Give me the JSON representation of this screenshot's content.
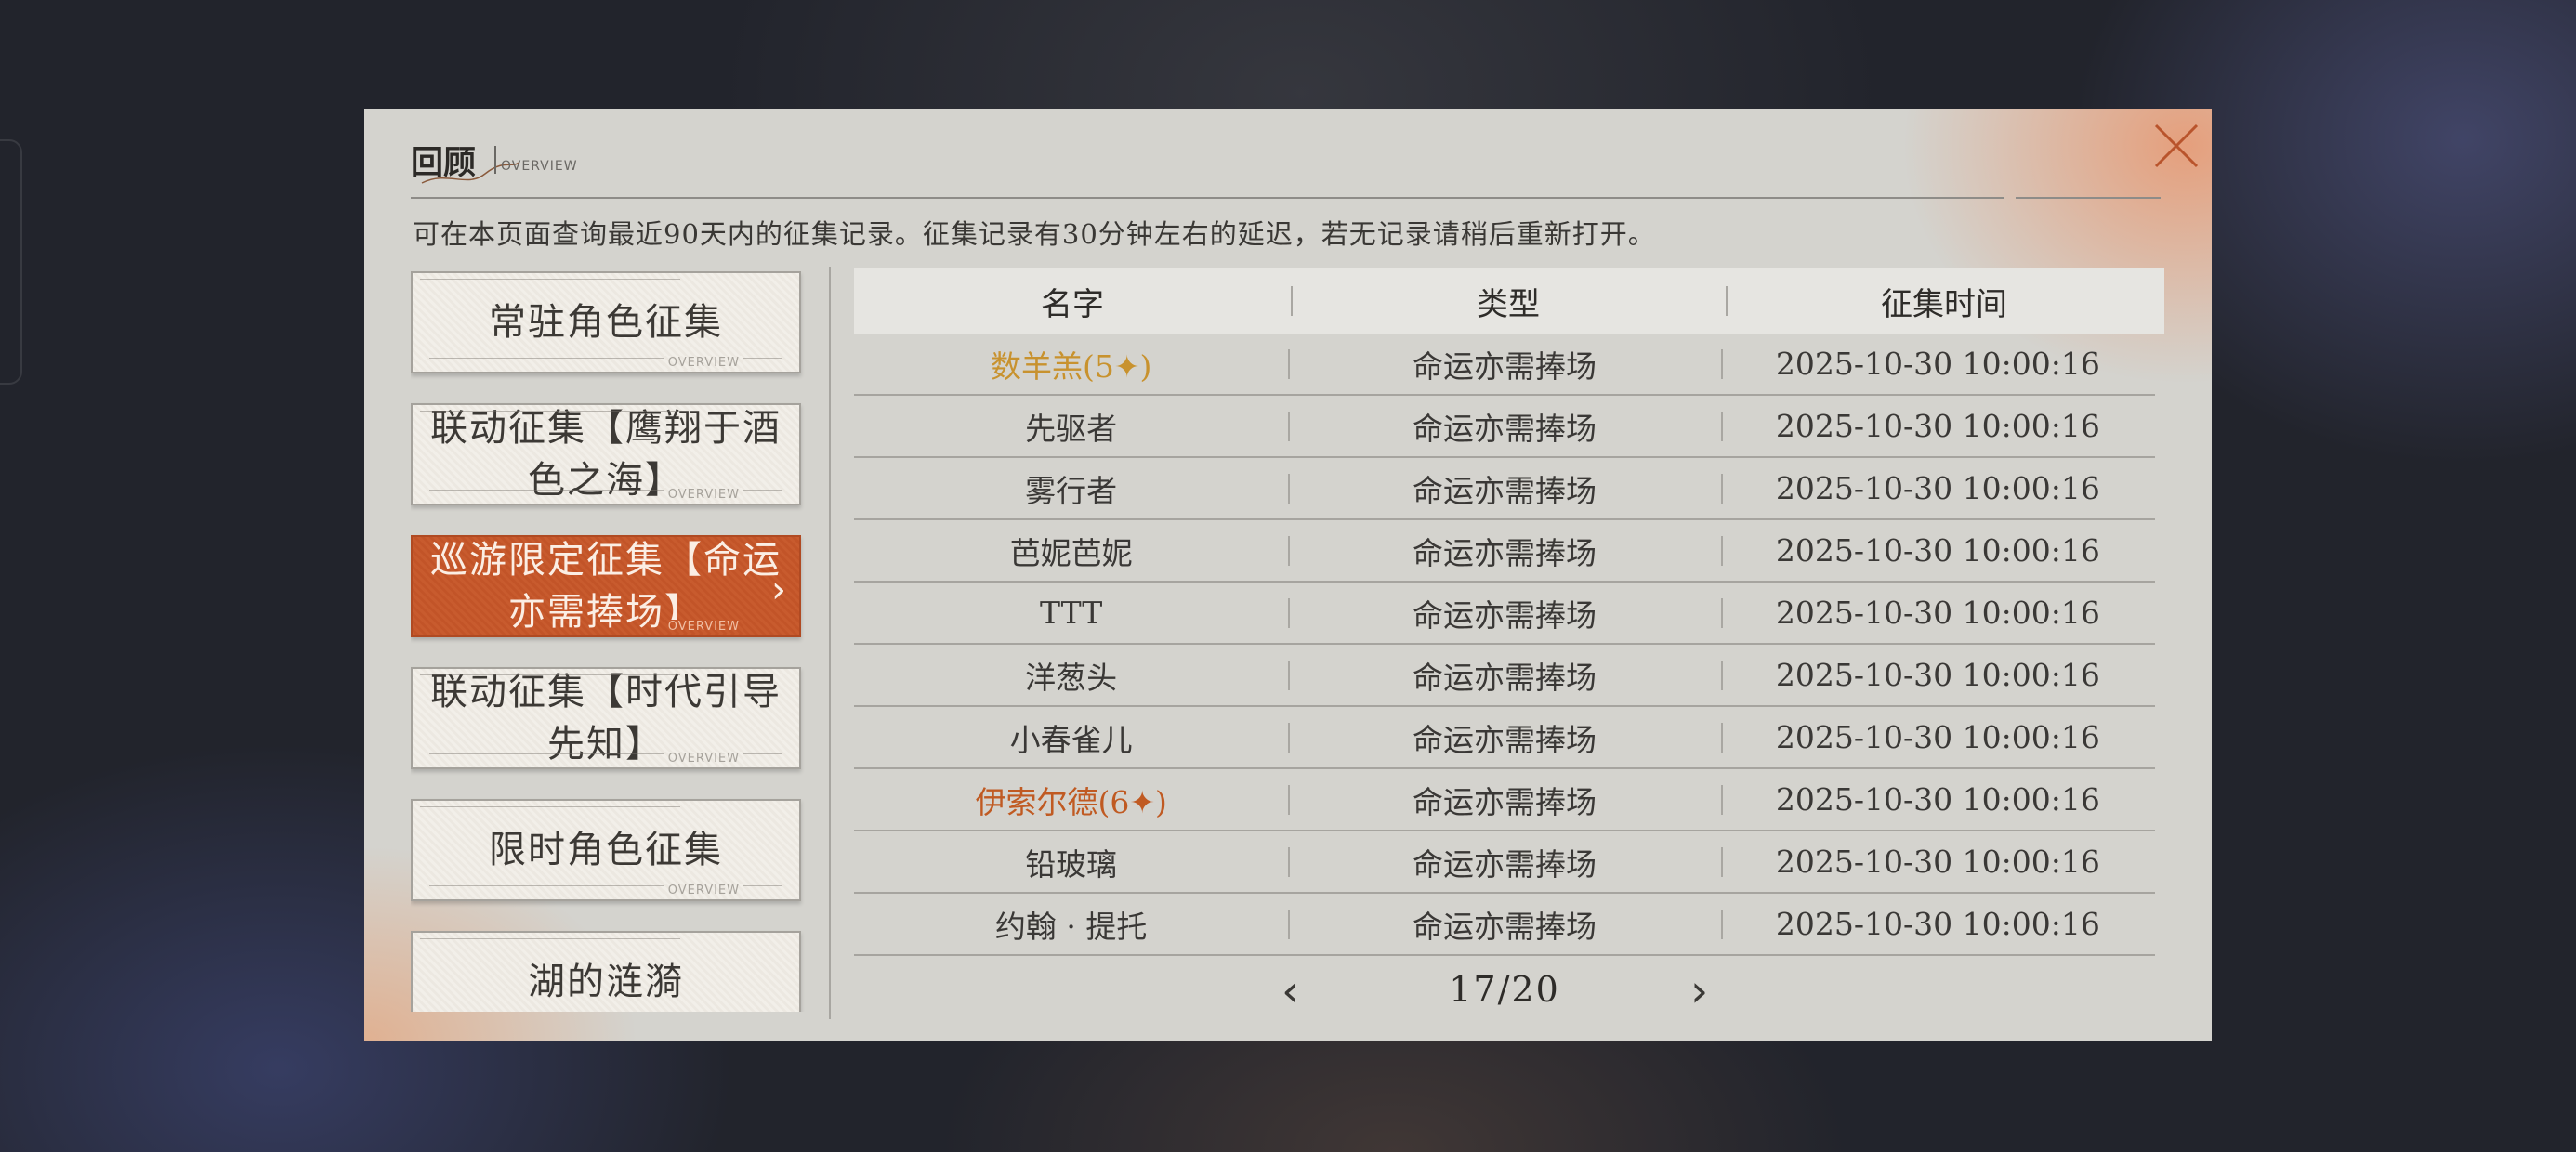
{
  "header": {
    "title": "回顾",
    "subtitle": "OVERVIEW",
    "description": "可在本页面查询最近90天内的征集记录。征集记录有30分钟左右的延迟，若无记录请稍后重新打开。",
    "close_icon": "close-icon"
  },
  "categories": [
    {
      "label": "常驻角色征集",
      "tag": "OVERVIEW",
      "active": false
    },
    {
      "label": "联动征集【鹰翔于酒色之海】",
      "tag": "OVERVIEW",
      "active": false
    },
    {
      "label": "巡游限定征集【命运亦需捧场】",
      "tag": "OVERVIEW",
      "active": true
    },
    {
      "label": "联动征集【时代引导先知】",
      "tag": "OVERVIEW",
      "active": false
    },
    {
      "label": "限时角色征集",
      "tag": "OVERVIEW",
      "active": false
    },
    {
      "label": "湖的涟漪",
      "tag": "OVERVIEW",
      "active": false
    }
  ],
  "table": {
    "headers": [
      "名字",
      "类型",
      "征集时间"
    ],
    "rows": [
      {
        "name": "数羊羔(5",
        "star": "✦",
        "close": ")",
        "rarity": 5,
        "type": "命运亦需捧场",
        "time": "2025-10-30 10:00:16"
      },
      {
        "name": "先驱者",
        "star": "",
        "close": "",
        "rarity": 0,
        "type": "命运亦需捧场",
        "time": "2025-10-30 10:00:16"
      },
      {
        "name": "雾行者",
        "star": "",
        "close": "",
        "rarity": 0,
        "type": "命运亦需捧场",
        "time": "2025-10-30 10:00:16"
      },
      {
        "name": "芭妮芭妮",
        "star": "",
        "close": "",
        "rarity": 0,
        "type": "命运亦需捧场",
        "time": "2025-10-30 10:00:16"
      },
      {
        "name": "TTT",
        "star": "",
        "close": "",
        "rarity": 0,
        "type": "命运亦需捧场",
        "time": "2025-10-30 10:00:16"
      },
      {
        "name": "洋葱头",
        "star": "",
        "close": "",
        "rarity": 0,
        "type": "命运亦需捧场",
        "time": "2025-10-30 10:00:16"
      },
      {
        "name": "小春雀儿",
        "star": "",
        "close": "",
        "rarity": 0,
        "type": "命运亦需捧场",
        "time": "2025-10-30 10:00:16"
      },
      {
        "name": "伊索尔德(6",
        "star": "✦",
        "close": ")",
        "rarity": 6,
        "type": "命运亦需捧场",
        "time": "2025-10-30 10:00:16"
      },
      {
        "name": "铅玻璃",
        "star": "",
        "close": "",
        "rarity": 0,
        "type": "命运亦需捧场",
        "time": "2025-10-30 10:00:16"
      },
      {
        "name": "约翰 · 提托",
        "star": "",
        "close": "",
        "rarity": 0,
        "type": "命运亦需捧场",
        "time": "2025-10-30 10:00:16"
      }
    ]
  },
  "pager": {
    "text": "17/20",
    "prev_icon": "chevron-left-icon",
    "next_icon": "chevron-right-icon"
  },
  "colors": {
    "accent": "#c85b2e",
    "rarity5": "#c8922e",
    "rarity6": "#c05a22"
  }
}
